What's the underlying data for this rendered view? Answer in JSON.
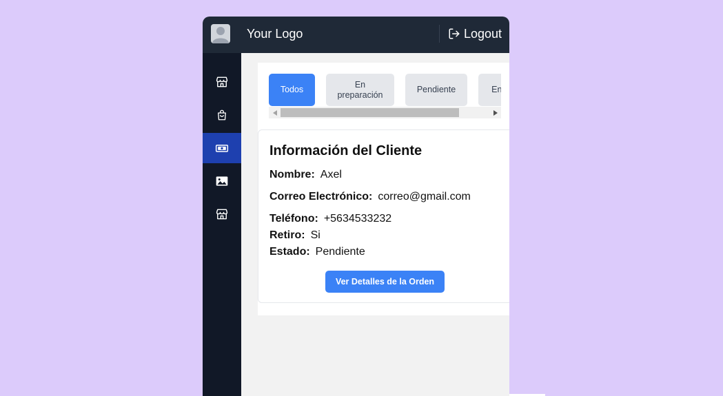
{
  "header": {
    "logo_text": "Your Logo",
    "logout_label": "Logout"
  },
  "sidebar": {
    "items": [
      {
        "icon": "store-icon",
        "active": false
      },
      {
        "icon": "shopping-bag-icon",
        "active": false
      },
      {
        "icon": "cash-icon",
        "active": true
      },
      {
        "icon": "image-icon",
        "active": false
      },
      {
        "icon": "store-icon",
        "active": false
      }
    ]
  },
  "filters": {
    "tabs": [
      {
        "label": "Todos",
        "active": true
      },
      {
        "label": "En\npreparación",
        "active": false
      },
      {
        "label": "Pendiente",
        "active": false
      },
      {
        "label": "Entregado",
        "active": false
      }
    ]
  },
  "order_card": {
    "title": "Información del Cliente",
    "name_label": "Nombre:",
    "name_value": "Axel",
    "email_label": "Correo Electrónico:",
    "email_value": "correo@gmail.com",
    "phone_label": "Teléfono:",
    "phone_value": "+5634533232",
    "pickup_label": "Retiro:",
    "pickup_value": "Si",
    "status_label": "Estado:",
    "status_value": "Pendiente",
    "details_button": "Ver Detalles de la Orden"
  },
  "colors": {
    "background": "#dccbfb",
    "topbar": "#1f2937",
    "sidebar": "#111827",
    "sidebar_active": "#1e40af",
    "accent": "#3b82f6"
  }
}
